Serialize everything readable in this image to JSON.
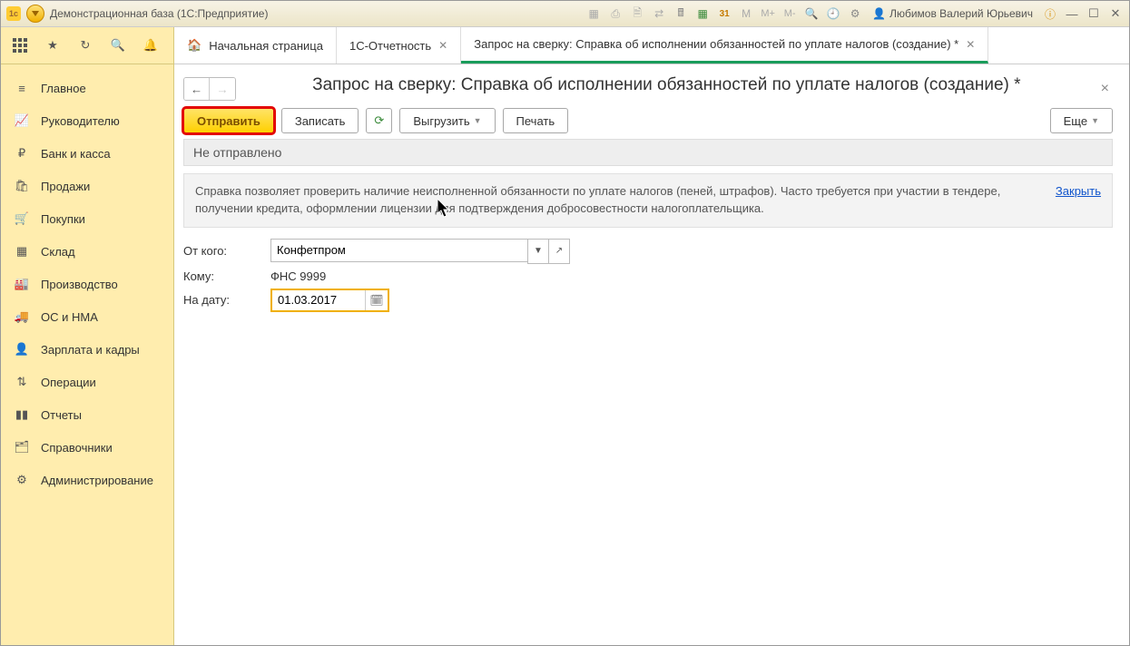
{
  "titlebar": {
    "title": "Демонстрационная база  (1С:Предприятие)",
    "user": "Любимов Валерий Юрьевич",
    "m1": "M",
    "m2": "M+",
    "m3": "M-",
    "date": "31"
  },
  "sidebar": {
    "items": [
      {
        "label": "Главное"
      },
      {
        "label": "Руководителю"
      },
      {
        "label": "Банк и касса"
      },
      {
        "label": "Продажи"
      },
      {
        "label": "Покупки"
      },
      {
        "label": "Склад"
      },
      {
        "label": "Производство"
      },
      {
        "label": "ОС и НМА"
      },
      {
        "label": "Зарплата и кадры"
      },
      {
        "label": "Операции"
      },
      {
        "label": "Отчеты"
      },
      {
        "label": "Справочники"
      },
      {
        "label": "Администрирование"
      }
    ]
  },
  "tabs": {
    "home": "Начальная страница",
    "t1": "1С-Отчетность",
    "t2": "Запрос на сверку: Справка об исполнении обязанностей по уплате налогов (создание) *"
  },
  "page": {
    "title": "Запрос на сверку: Справка об исполнении обязанностей по уплате налогов (создание) *",
    "btn_send": "Отправить",
    "btn_write": "Записать",
    "btn_export": "Выгрузить",
    "btn_print": "Печать",
    "btn_more": "Еще",
    "status": "Не отправлено",
    "info": "Справка позволяет проверить наличие неисполненной обязанности по уплате налогов (пеней, штрафов). Часто требуется при участии в тендере, получении кредита, оформлении лицензии для подтверждения добросовестности налогоплательщика.",
    "info_close": "Закрыть",
    "from_lbl": "От кого:",
    "from_val": "Конфетпром",
    "to_lbl": "Кому:",
    "to_val": "ФНС 9999",
    "date_lbl": "На дату:",
    "date_val": "01.03.2017"
  }
}
